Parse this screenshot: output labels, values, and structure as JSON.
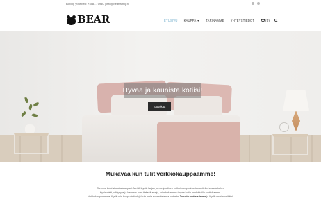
{
  "topbar": {
    "contact": "Boxing your bed: +358 ... 0940 | info@bearfamily.fi"
  },
  "header": {
    "logo_text": "BEAR",
    "nav": [
      {
        "label": "ETUSIVU",
        "active": true
      },
      {
        "label": "KAUPPA",
        "has_dropdown": true
      },
      {
        "label": "TARINAMME"
      },
      {
        "label": "YHTEYSTIEDOT"
      }
    ],
    "cart_count": "(0)"
  },
  "hero": {
    "title": "Hyvää ja kaunista kotiisi!",
    "button_label": "Katsokaa"
  },
  "intro": {
    "heading": "Mukavaa kun tulit verkkokauppaamme!",
    "line1": "Olemme kotoi sisustuskauppani. Meiltä löydät laajan ja monipuolisen valikoiman pienisustustuotteita huonekaluihin.",
    "line2": "Hyvinvointi, viihtyvyys ja kauneus ovat tärkeitä arvoja, joita haluamme tarjota kotiin laadukkailla tuotteillamme.",
    "line3_pre": "Verkkokauppaamme löydät niin kuppiu brändejä kuin omia suunnittelemia tuotteita.",
    "line3_bold": "Tutustu tuotteisiimme",
    "line3_post": "ja löydä omat suosikkisi!"
  },
  "colors": {
    "accent_nav_active": "#6aa9c9",
    "button_dark": "#2b2b2b"
  }
}
